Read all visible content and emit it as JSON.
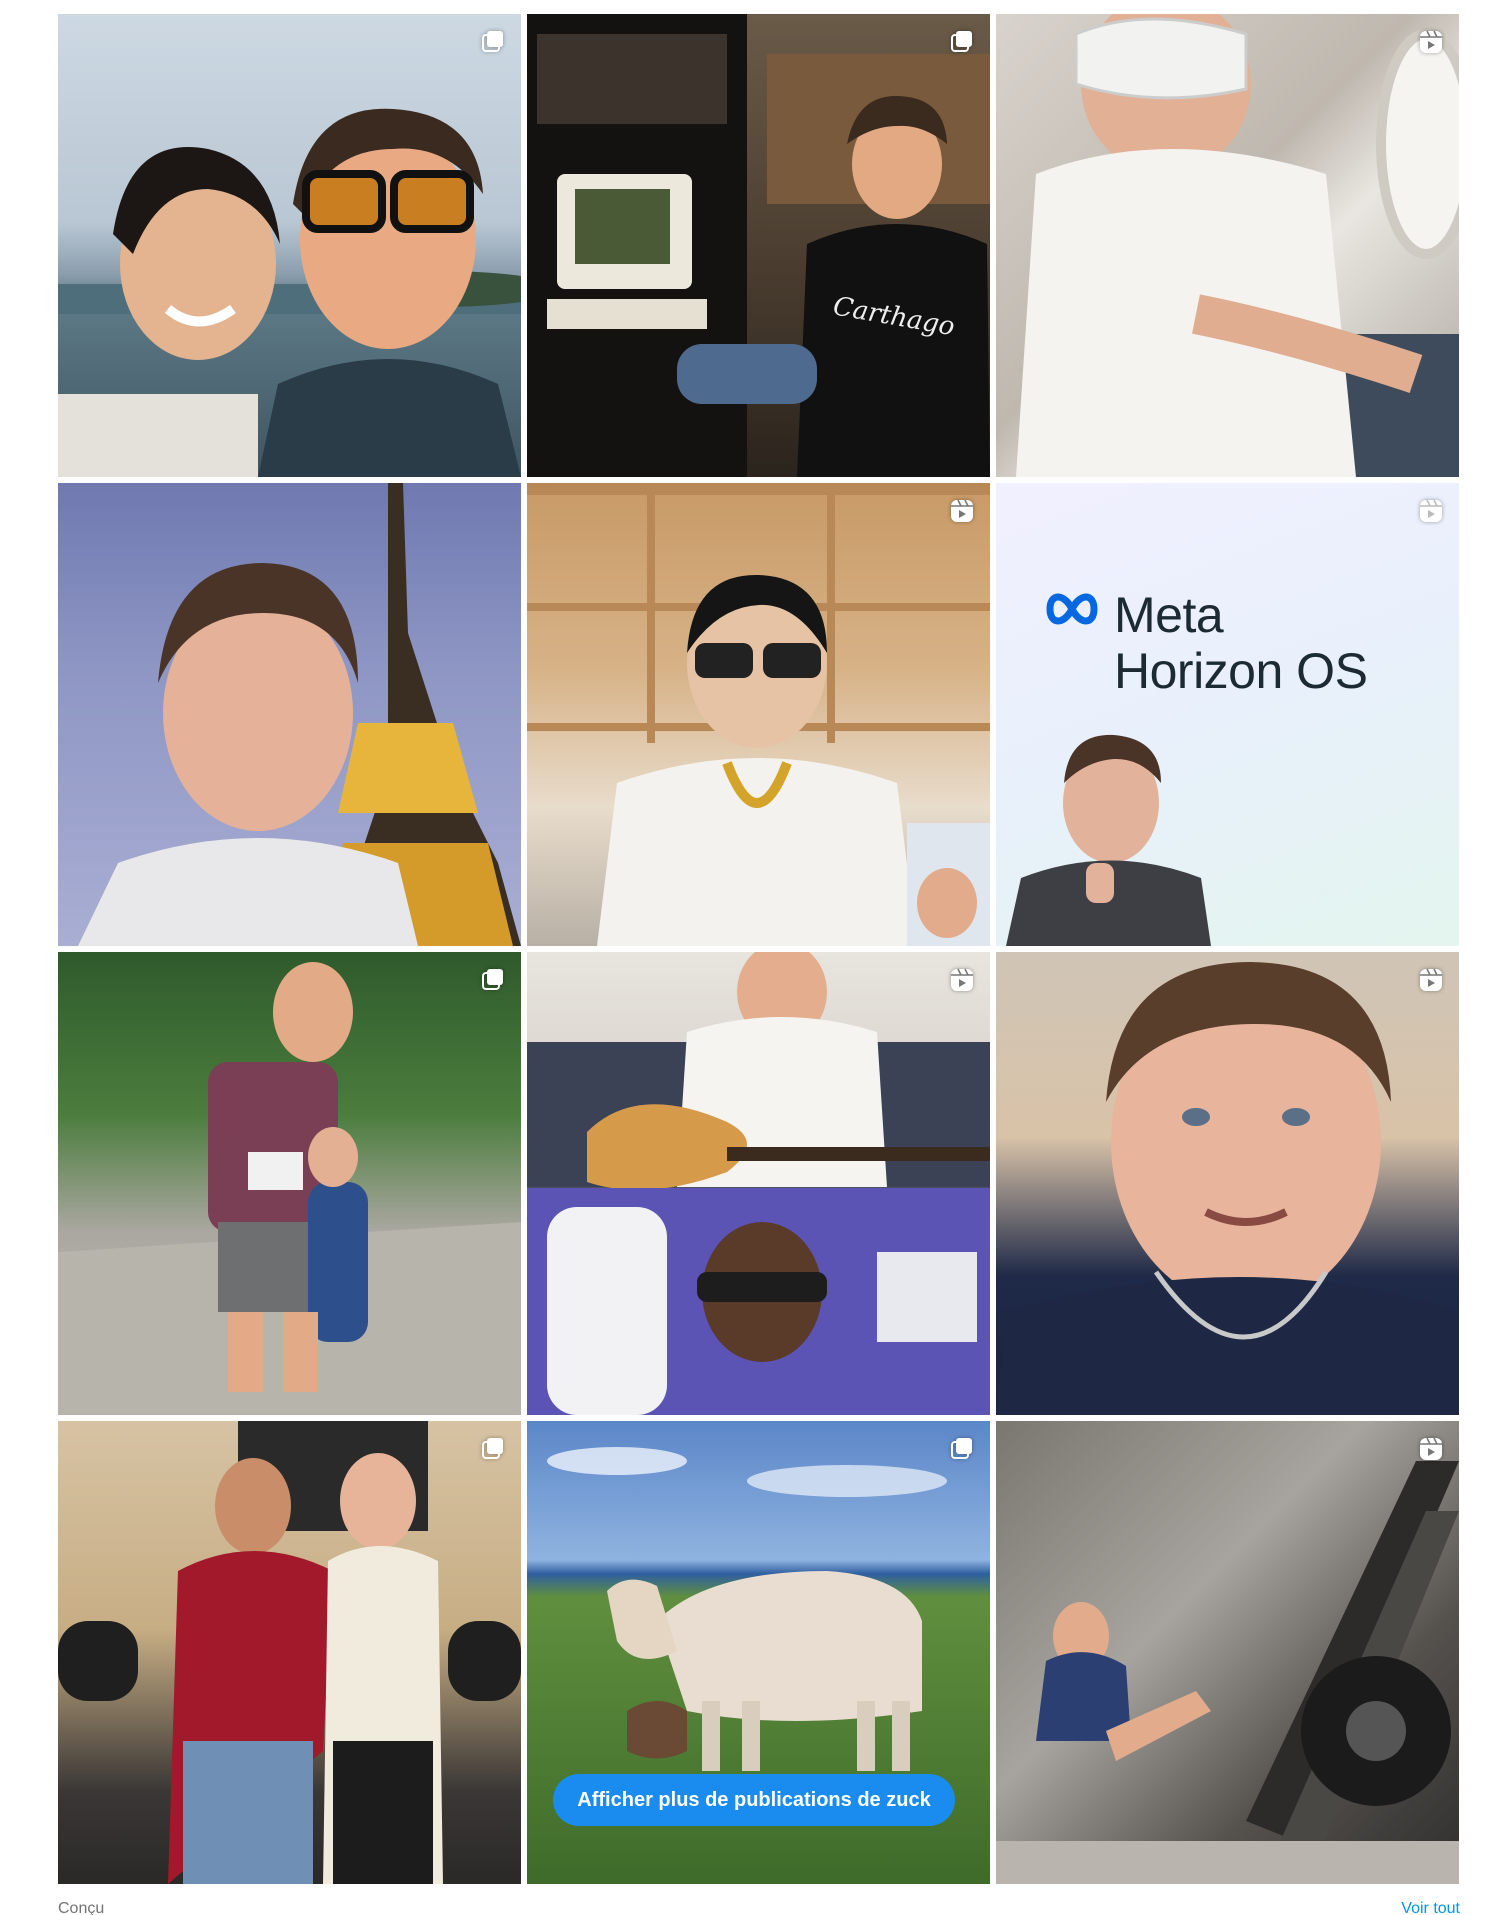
{
  "grid": {
    "posts": [
      {
        "kind": "carousel",
        "scene": "selfie-sea",
        "media": "selfie-at-sea-photo"
      },
      {
        "kind": "carousel",
        "scene": "dorm",
        "media": "dorm-room-computer-photo"
      },
      {
        "kind": "reel",
        "scene": "plane",
        "media": "vr-headset-on-plane-photo"
      },
      {
        "kind": "none",
        "scene": "eiffel",
        "media": "eiffel-tower-selfie-photo"
      },
      {
        "kind": "reel",
        "scene": "shelves",
        "media": "smart-glasses-video-call-photo"
      },
      {
        "kind": "reel",
        "scene": "meta",
        "media": "meta-horizon-os-announcement"
      },
      {
        "kind": "carousel",
        "scene": "garden",
        "media": "garden-race-bib-photo"
      },
      {
        "kind": "reel",
        "scene": "guitar",
        "media": "guitar-and-gamer-split-photo"
      },
      {
        "kind": "reel",
        "scene": "closeup",
        "media": "closeup-talking-video"
      },
      {
        "kind": "carousel",
        "scene": "ufc",
        "media": "ufc-locker-room-photo"
      },
      {
        "kind": "carousel",
        "scene": "cow",
        "media": "cow-and-calf-field-photo"
      },
      {
        "kind": "reel",
        "scene": "gym",
        "media": "leg-press-gym-video"
      }
    ]
  },
  "meta_post": {
    "line1": "Meta",
    "line2": "Horizon OS",
    "brand_color": "#0668E1"
  },
  "cta": {
    "label": "Afficher plus de publications de zuck",
    "color": "#1a8cf0"
  },
  "footer": {
    "left": "Conçu",
    "right": "Voir tout"
  },
  "icons": {
    "carousel": "carousel-icon",
    "reel": "reel-icon"
  }
}
